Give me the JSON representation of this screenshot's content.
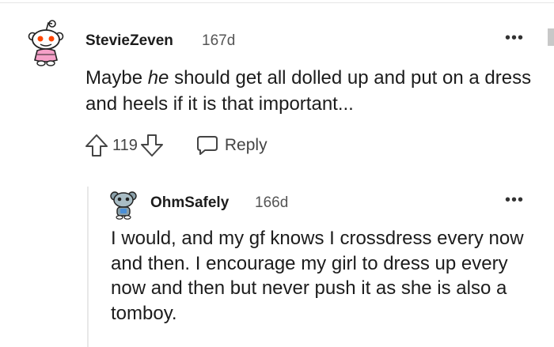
{
  "comments": [
    {
      "author": "StevieZeven",
      "age": "167d",
      "body_before": "Maybe ",
      "body_em": "he",
      "body_after": " should get all dolled up and put on a dress and heels if it is that important...",
      "votes": "119",
      "reply_label": "Reply",
      "more_label": "•••",
      "avatar_icon": "snoo-avatar-icon"
    },
    {
      "author": "OhmSafely",
      "age": "166d",
      "body": "I would, and my gf knows I crossdress every now and then. I encourage my girl to dress up every now and then but never push it as she is also a tomboy.",
      "more_label": "•••",
      "avatar_icon": "snoo-avatar-icon"
    }
  ],
  "colors": {
    "text": "#1c1c1c",
    "meta": "#555555",
    "icon": "#444444",
    "thread_line": "#e8e8e8",
    "avatar_accent": "#ff4500",
    "avatar_pink": "#f5a0c8"
  }
}
